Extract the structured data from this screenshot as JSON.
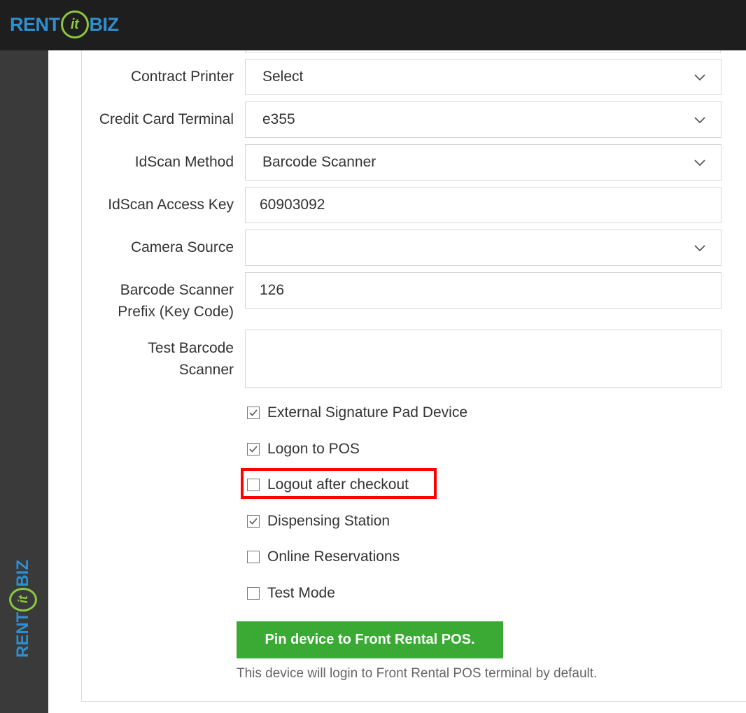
{
  "brand": {
    "logo_left": "RENT",
    "logo_mid": "it",
    "logo_right": "BIZ"
  },
  "form": {
    "contract_printer": {
      "label": "Contract Printer",
      "value": "Select"
    },
    "credit_card_terminal": {
      "label": "Credit Card Terminal",
      "value": "e355"
    },
    "idscan_method": {
      "label": "IdScan Method",
      "value": "Barcode Scanner"
    },
    "idscan_access_key": {
      "label": "IdScan Access Key",
      "value": "60903092"
    },
    "camera_source": {
      "label": "Camera Source",
      "value": ""
    },
    "barcode_prefix": {
      "label_line1": "Barcode Scanner",
      "label_line2": "Prefix (Key Code)",
      "value": "126"
    },
    "test_barcode": {
      "label_line1": "Test Barcode",
      "label_line2": "Scanner",
      "value": ""
    }
  },
  "checkboxes": [
    {
      "label": "External Signature Pad Device",
      "checked": true
    },
    {
      "label": "Logon to POS",
      "checked": true
    },
    {
      "label": "Logout after checkout",
      "checked": false
    },
    {
      "label": "Dispensing Station",
      "checked": true
    },
    {
      "label": "Online Reservations",
      "checked": false
    },
    {
      "label": "Test Mode",
      "checked": false
    }
  ],
  "pin_button": {
    "label": "Pin device to Front Rental POS."
  },
  "help_text": "This device will login to Front Rental POS terminal by default.",
  "colors": {
    "brand_blue": "#2e8fd0",
    "brand_green": "#8dc63f",
    "button_green": "#3aaa35",
    "highlight": "#ff0000"
  }
}
